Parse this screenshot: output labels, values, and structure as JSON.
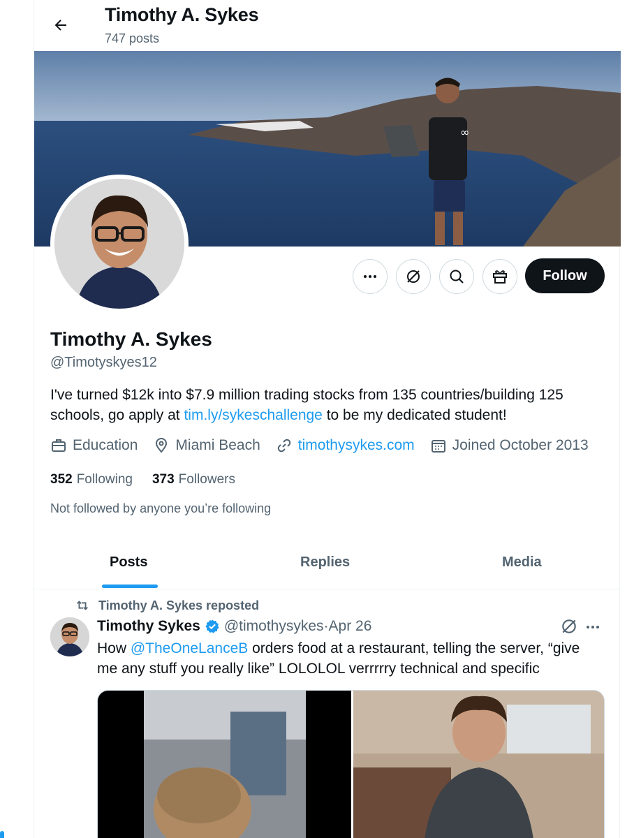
{
  "header": {
    "title": "Timothy A. Sykes",
    "post_count": "747 posts"
  },
  "profile": {
    "name": "Timothy A. Sykes",
    "handle": "@Timotyskyes12",
    "bio_text": "I've turned $12k into $7.9 million trading stocks from 135 countries/building 125 schools, go apply at ",
    "bio_link": "tim.ly/sykeschallenge",
    "bio_end": " to be my dedicated student!",
    "category": "Education",
    "location": "Miami Beach",
    "website": "timothysykes.com",
    "joined": "Joined October 2013",
    "following_count": "352",
    "following_label": "Following",
    "followers_count": "373",
    "followers_label": "Followers",
    "not_followed": "Not followed by anyone you’re following",
    "follow_label": "Follow"
  },
  "tabs": [
    {
      "label": "Posts",
      "active": true
    },
    {
      "label": "Replies",
      "active": false
    },
    {
      "label": "Media",
      "active": false
    }
  ],
  "post": {
    "repost_label": "Timothy A. Sykes reposted",
    "author_name": "Timothy Sykes",
    "author_handle": "@timothysykes",
    "separator": " · ",
    "date": "Apr 26",
    "text_before": "How ",
    "mention": "@TheOneLanceB",
    "text_after": " orders food at a restaurant, telling the server, “give me any stuff you really like” LOLOLOL verrrrry technical and specific"
  },
  "colors": {
    "accent": "#1d9bf0",
    "text": "#0f1419",
    "secondary": "#536471"
  },
  "icons": [
    "back-arrow-icon",
    "more-icon",
    "grok-icon",
    "search-icon",
    "gift-icon",
    "briefcase-icon",
    "location-icon",
    "link-icon",
    "calendar-icon",
    "repost-icon",
    "verified-icon"
  ]
}
